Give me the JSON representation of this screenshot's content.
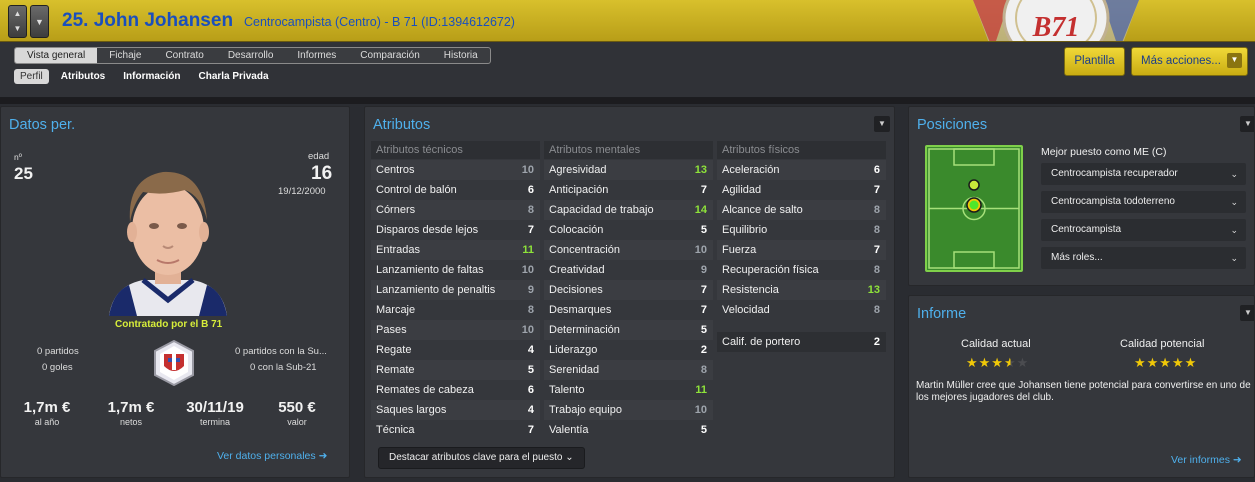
{
  "header": {
    "title": "25. John Johansen",
    "subtitle": "Centrocampista (Centro) - B 71 (ID:1394612672)",
    "crest_text": "B71"
  },
  "nav": {
    "up_icon": "arrow-up-icon",
    "down_icon": "arrow-down-icon",
    "menu_icon": "chevron-down-icon"
  },
  "tabs": [
    "Vista general",
    "Fichaje",
    "Contrato",
    "Desarrollo",
    "Informes",
    "Comparación",
    "Historia"
  ],
  "subtabs": [
    "Perfil",
    "Atributos",
    "Información",
    "Charla Privada"
  ],
  "buttons": {
    "squad": "Plantilla",
    "more_actions": "Más acciones..."
  },
  "personal": {
    "heading": "Datos per.",
    "number_label": "nº",
    "number": "25",
    "age_label": "edad",
    "age": "16",
    "dob": "19/12/2000",
    "contract_note": "Contratado por el B 71",
    "matches": "0 partidos",
    "goals": "0 goles",
    "u21_matches": "0 partidos con la Su...",
    "u21_goals": "0 con la Sub-21",
    "stats": [
      {
        "value": "1,7m €",
        "caption": "al año"
      },
      {
        "value": "1,7m €",
        "caption": "netos"
      },
      {
        "value": "30/11/19",
        "caption": "termina"
      },
      {
        "value": "550 €",
        "caption": "valor"
      }
    ],
    "link": "Ver datos personales"
  },
  "attributes": {
    "heading": "Atributos",
    "columns": [
      {
        "title": "Atributos técnicos",
        "rows": [
          {
            "name": "Centros",
            "value": "10"
          },
          {
            "name": "Control de balón",
            "value": "6"
          },
          {
            "name": "Córners",
            "value": "8"
          },
          {
            "name": "Disparos desde lejos",
            "value": "7"
          },
          {
            "name": "Entradas",
            "value": "11"
          },
          {
            "name": "Lanzamiento de faltas",
            "value": "10"
          },
          {
            "name": "Lanzamiento de penaltis",
            "value": "9"
          },
          {
            "name": "Marcaje",
            "value": "8"
          },
          {
            "name": "Pases",
            "value": "10"
          },
          {
            "name": "Regate",
            "value": "4"
          },
          {
            "name": "Remate",
            "value": "5"
          },
          {
            "name": "Remates de cabeza",
            "value": "6"
          },
          {
            "name": "Saques largos",
            "value": "4"
          },
          {
            "name": "Técnica",
            "value": "7"
          }
        ]
      },
      {
        "title": "Atributos mentales",
        "rows": [
          {
            "name": "Agresividad",
            "value": "13"
          },
          {
            "name": "Anticipación",
            "value": "7"
          },
          {
            "name": "Capacidad de trabajo",
            "value": "14"
          },
          {
            "name": "Colocación",
            "value": "5"
          },
          {
            "name": "Concentración",
            "value": "10"
          },
          {
            "name": "Creatividad",
            "value": "9"
          },
          {
            "name": "Decisiones",
            "value": "7"
          },
          {
            "name": "Desmarques",
            "value": "7"
          },
          {
            "name": "Determinación",
            "value": "5"
          },
          {
            "name": "Liderazgo",
            "value": "2"
          },
          {
            "name": "Serenidad",
            "value": "8"
          },
          {
            "name": "Talento",
            "value": "11"
          },
          {
            "name": "Trabajo equipo",
            "value": "10"
          },
          {
            "name": "Valentía",
            "value": "5"
          }
        ]
      },
      {
        "title": "Atributos físicos",
        "rows": [
          {
            "name": "Aceleración",
            "value": "6"
          },
          {
            "name": "Agilidad",
            "value": "7"
          },
          {
            "name": "Alcance de salto",
            "value": "8"
          },
          {
            "name": "Equilibrio",
            "value": "8"
          },
          {
            "name": "Fuerza",
            "value": "7"
          },
          {
            "name": "Recuperación física",
            "value": "8"
          },
          {
            "name": "Resistencia",
            "value": "13"
          },
          {
            "name": "Velocidad",
            "value": "8"
          }
        ]
      }
    ],
    "goalkeeper": {
      "name": "Calif. de portero",
      "value": "2"
    },
    "highlight_button": "Destacar atributos clave para el puesto"
  },
  "positions": {
    "heading": "Posiciones",
    "best_role_title": "Mejor puesto como ME (C)",
    "roles": [
      "Centrocampista recuperador",
      "Centrocampista todoterreno",
      "Centrocampista",
      "Más roles..."
    ]
  },
  "report": {
    "heading": "Informe",
    "current_label": "Calidad actual",
    "current_stars": 3.5,
    "potential_label": "Calidad potencial",
    "potential_stars": 5,
    "text": "Martin Müller cree que Johansen tiene potencial para convertirse en uno de los mejores jugadores del club.",
    "link": "Ver informes"
  },
  "colors": {
    "title_bg": "#d8c02c",
    "accent_blue": "#4fb0ec",
    "high_value": "#8ee33a",
    "star": "#f0c808"
  }
}
